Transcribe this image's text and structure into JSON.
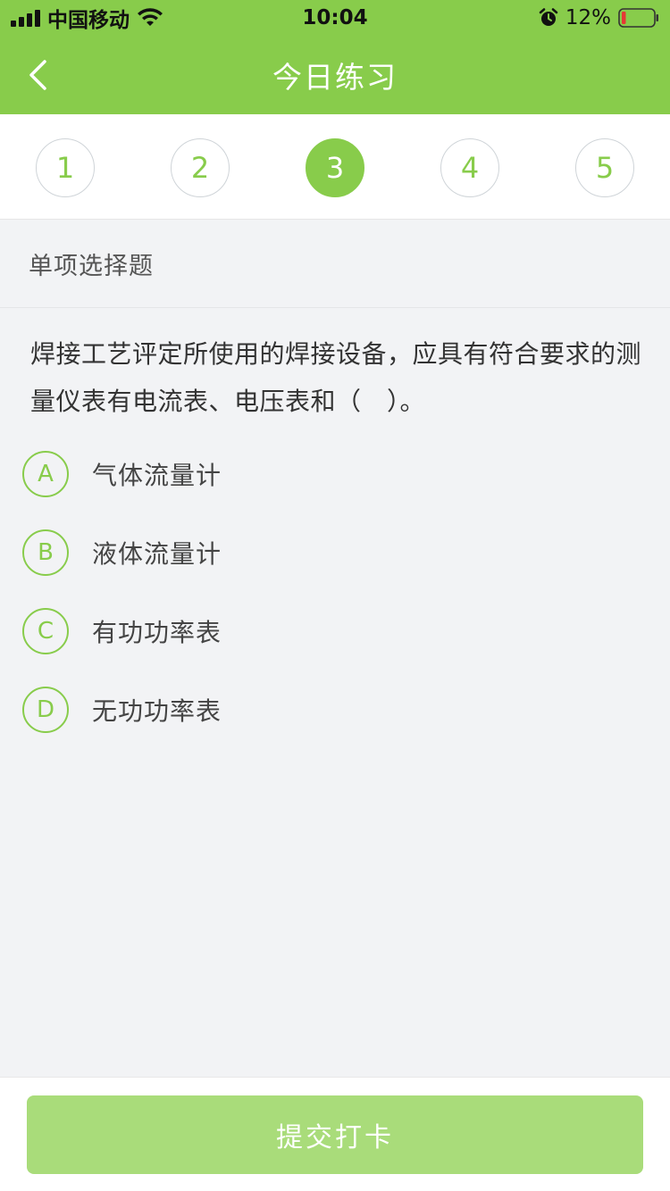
{
  "status_bar": {
    "carrier": "中国移动",
    "time": "10:04",
    "battery_percent": "12%"
  },
  "nav": {
    "title": "今日练习",
    "back_icon": "chevron-left-icon"
  },
  "steps": {
    "items": [
      "1",
      "2",
      "3",
      "4",
      "5"
    ],
    "active_index": 2
  },
  "question": {
    "type": "单项选择题",
    "text": "焊接工艺评定所使用的焊接设备，应具有符合要求的测量仪表有电流表、电压表和（　）。",
    "options": [
      {
        "letter": "A",
        "text": "气体流量计"
      },
      {
        "letter": "B",
        "text": "液体流量计"
      },
      {
        "letter": "C",
        "text": "有功功率表"
      },
      {
        "letter": "D",
        "text": "无功功率表"
      }
    ]
  },
  "footer": {
    "submit_label": "提交打卡"
  },
  "colors": {
    "brand_green": "#88cc4b",
    "button_green_disabled": "#a9dc7a",
    "background": "#f2f3f5"
  }
}
